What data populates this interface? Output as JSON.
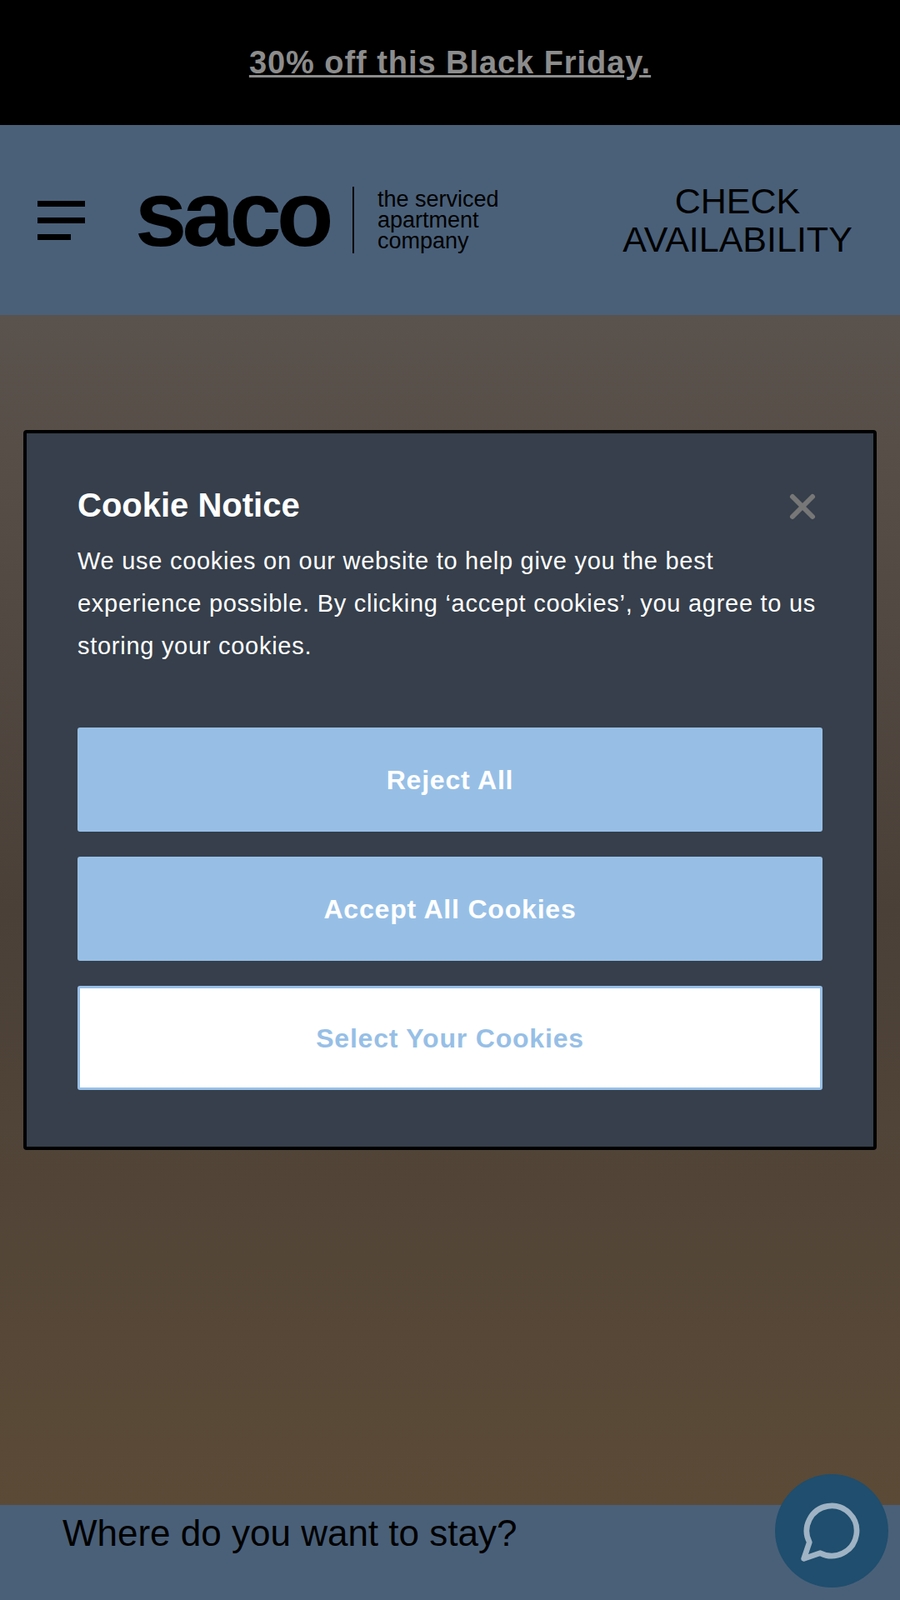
{
  "banner": {
    "text": "30% off this Black Friday."
  },
  "header": {
    "logo": {
      "name": "saco",
      "tagline": [
        "the serviced",
        "apartment",
        "company"
      ]
    },
    "cta": "CHECK AVAILABILITY"
  },
  "cookie_notice": {
    "title": "Cookie Notice",
    "body": "We use cookies on our website to help give you the best experience possible. By clicking ‘accept cookies’, you agree to us storing your cookies.",
    "buttons": [
      {
        "label": "Reject All",
        "kind": "filled"
      },
      {
        "label": "Accept All Cookies",
        "kind": "filled"
      },
      {
        "label": "Select Your Cookies",
        "kind": "outline"
      }
    ]
  },
  "section": {
    "heading": "Where do you want to stay?"
  }
}
